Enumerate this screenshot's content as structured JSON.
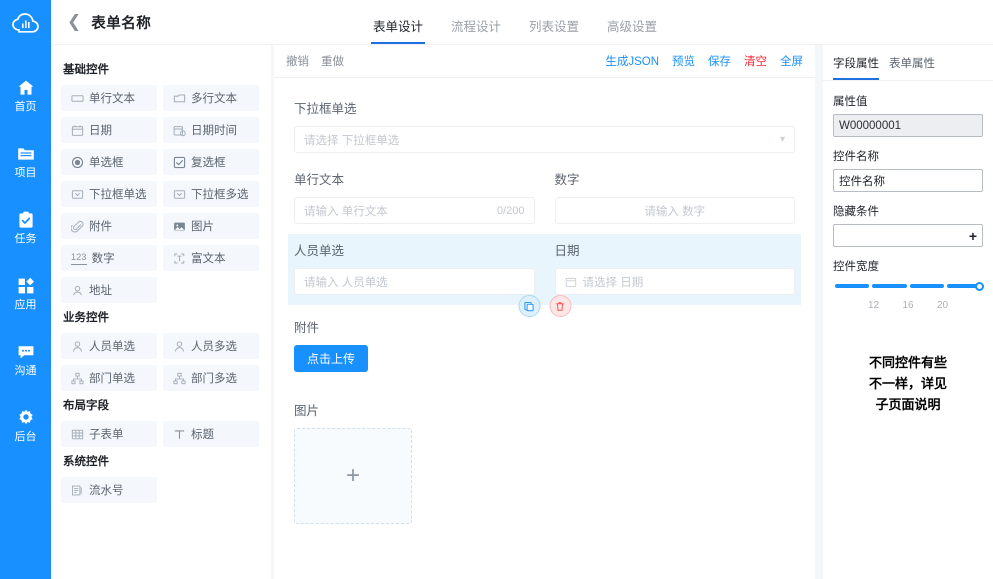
{
  "brand": {
    "accent": "#1890ff",
    "danger": "#f5222d",
    "logo_name": "cloud-chart-logo"
  },
  "rail": {
    "items": [
      {
        "label": "首页",
        "icon": "home-icon"
      },
      {
        "label": "项目",
        "icon": "folder-icon"
      },
      {
        "label": "任务",
        "icon": "clipboard-check-icon"
      },
      {
        "label": "应用",
        "icon": "apps-grid-icon"
      },
      {
        "label": "沟通",
        "icon": "chat-bubble-icon"
      },
      {
        "label": "后台",
        "icon": "gear-icon"
      }
    ]
  },
  "header": {
    "back_icon": "chevron-left-icon",
    "title": "表单名称",
    "tabs": [
      {
        "label": "表单设计",
        "active": true
      },
      {
        "label": "流程设计",
        "active": false
      },
      {
        "label": "列表设置",
        "active": false
      },
      {
        "label": "高级设置",
        "active": false
      }
    ]
  },
  "palette": {
    "groups": [
      {
        "title": "基础控件",
        "items": [
          {
            "label": "单行文本",
            "icon": "single-line-text-icon"
          },
          {
            "label": "多行文本",
            "icon": "multi-line-text-icon"
          },
          {
            "label": "日期",
            "icon": "calendar-icon"
          },
          {
            "label": "日期时间",
            "icon": "calendar-clock-icon"
          },
          {
            "label": "单选框",
            "icon": "radio-icon"
          },
          {
            "label": "复选框",
            "icon": "checkbox-icon"
          },
          {
            "label": "下拉框单选",
            "icon": "select-single-icon"
          },
          {
            "label": "下拉框多选",
            "icon": "select-multi-icon"
          },
          {
            "label": "附件",
            "icon": "paperclip-icon"
          },
          {
            "label": "图片",
            "icon": "image-icon"
          },
          {
            "label": "数字",
            "icon": "number-123-icon"
          },
          {
            "label": "富文本",
            "icon": "rich-text-icon"
          },
          {
            "label": "地址",
            "icon": "address-pin-icon"
          }
        ]
      },
      {
        "title": "业务控件",
        "items": [
          {
            "label": "人员单选",
            "icon": "person-icon"
          },
          {
            "label": "人员多选",
            "icon": "person-icon"
          },
          {
            "label": "部门单选",
            "icon": "org-tree-icon"
          },
          {
            "label": "部门多选",
            "icon": "org-tree-icon"
          }
        ]
      },
      {
        "title": "布局字段",
        "items": [
          {
            "label": "子表单",
            "icon": "table-icon"
          },
          {
            "label": "标题",
            "icon": "text-t-icon"
          }
        ]
      },
      {
        "title": "系统控件",
        "items": [
          {
            "label": "流水号",
            "icon": "serial-number-icon"
          }
        ]
      }
    ]
  },
  "toolbar": {
    "undo": "撤销",
    "redo": "重做",
    "generate_json": "生成JSON",
    "preview": "预览",
    "save": "保存",
    "clear": "清空",
    "fullscreen": "全屏"
  },
  "canvas": {
    "rows": [
      {
        "selected": false,
        "fields": [
          {
            "label": "下拉框单选",
            "type": "select",
            "placeholder": "请选择 下拉框单选",
            "value": ""
          }
        ]
      },
      {
        "selected": false,
        "fields": [
          {
            "label": "单行文本",
            "type": "text",
            "placeholder": "请输入 单行文本",
            "value": "",
            "counter": "0/200"
          },
          {
            "label": "数字",
            "type": "number",
            "placeholder": "请输入 数字",
            "value": ""
          }
        ]
      },
      {
        "selected": true,
        "fields": [
          {
            "label": "人员单选",
            "type": "text",
            "placeholder": "请输入 人员单选",
            "value": ""
          },
          {
            "label": "日期",
            "type": "date",
            "placeholder": "请选择 日期",
            "value": ""
          }
        ],
        "actions": {
          "copy": "copy-icon",
          "delete": "trash-icon"
        }
      },
      {
        "selected": false,
        "fields": [
          {
            "label": "附件",
            "type": "upload-button",
            "button_label": "点击上传"
          }
        ]
      },
      {
        "selected": false,
        "fields": [
          {
            "label": "图片",
            "type": "image-upload",
            "add_glyph": "+"
          }
        ]
      }
    ]
  },
  "props": {
    "tabs": [
      {
        "label": "字段属性",
        "active": true
      },
      {
        "label": "表单属性",
        "active": false
      }
    ],
    "attr_value_label": "属性值",
    "attr_value": "W00000001",
    "widget_name_label": "控件名称",
    "widget_name": "控件名称",
    "hidden_cond_label": "隐藏条件",
    "hidden_cond": "",
    "add_icon": "+",
    "width_label": "控件宽度",
    "width_marks": [
      "12",
      "16",
      "20"
    ],
    "width_mark_positions": [
      27,
      50,
      73
    ],
    "note": "不同控件有些\n不一样，详见\n子页面说明",
    "note_lines": [
      "不同控件有些",
      "不一样，详见",
      "子页面说明"
    ]
  }
}
